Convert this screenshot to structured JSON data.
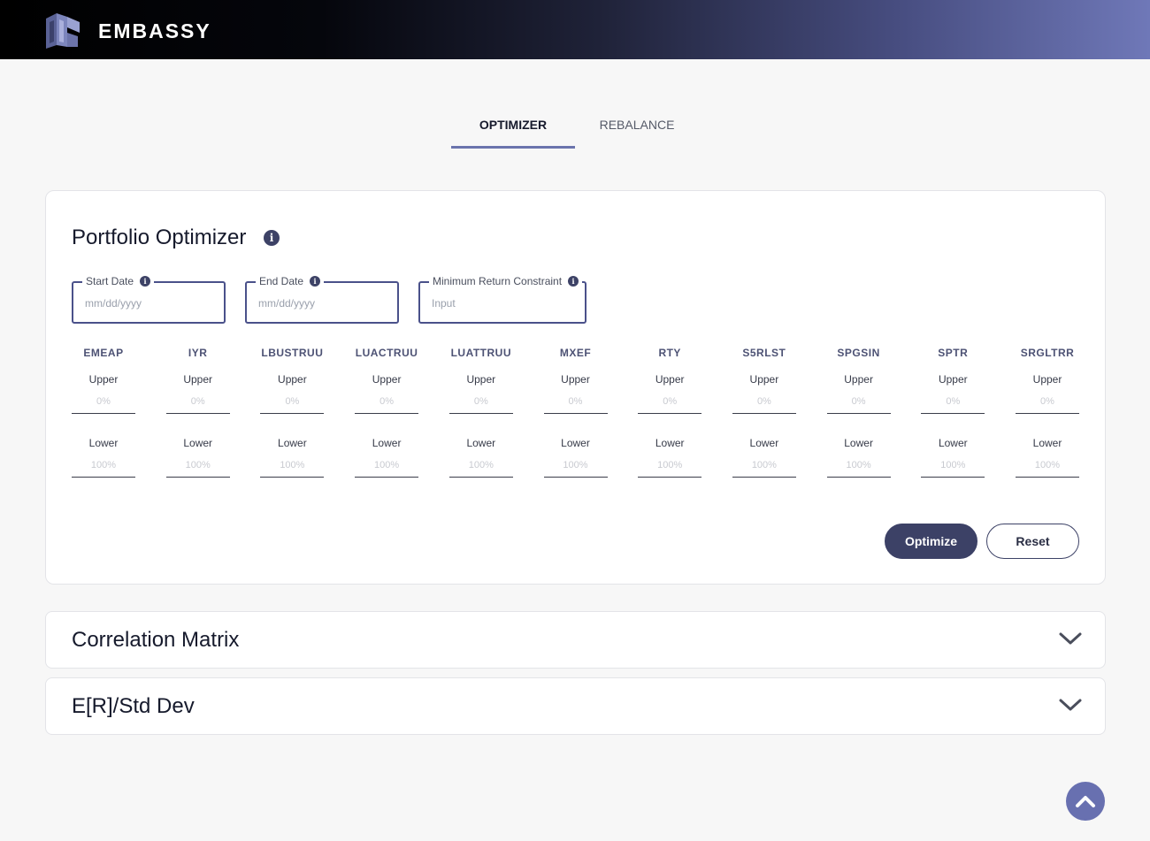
{
  "header": {
    "brand": "EMBASSY",
    "logo_icon": "embassy-logo-icon"
  },
  "tabs": [
    {
      "label": "OPTIMIZER",
      "active": true
    },
    {
      "label": "REBALANCE",
      "active": false
    }
  ],
  "optimizer": {
    "title": "Portfolio Optimizer",
    "fields": {
      "start_date": {
        "label": "Start Date",
        "placeholder": "mm/dd/yyyy"
      },
      "end_date": {
        "label": "End Date",
        "placeholder": "mm/dd/yyyy"
      },
      "min_return": {
        "label": "Minimum Return Constraint",
        "placeholder": "Input"
      }
    },
    "upper_label": "Upper",
    "lower_label": "Lower",
    "upper_placeholder": "0%",
    "lower_placeholder": "100%",
    "assets": [
      "EMEAP",
      "IYR",
      "LBUSTRUU",
      "LUACTRUU",
      "LUATTRUU",
      "MXEF",
      "RTY",
      "S5RLST",
      "SPGSIN",
      "SPTR",
      "SRGLTRR"
    ],
    "optimize_label": "Optimize",
    "reset_label": "Reset"
  },
  "sections": {
    "correlation": {
      "title": "Correlation Matrix"
    },
    "er_std": {
      "title": "E[R]/Std Dev"
    }
  },
  "colors": {
    "accent": "#6b74ad",
    "primary_button": "#3c4166",
    "scroll_button": "#6870b0"
  }
}
